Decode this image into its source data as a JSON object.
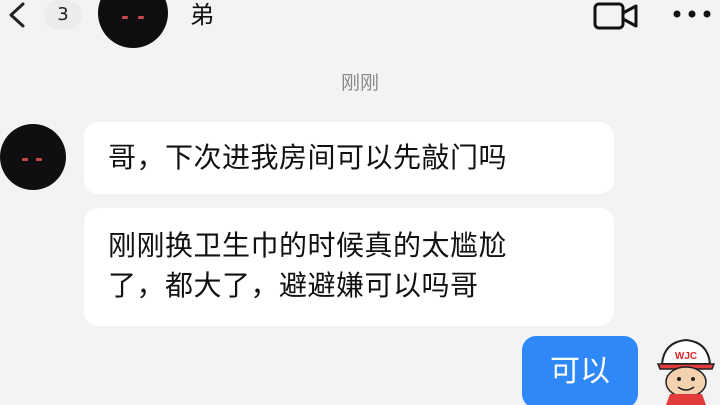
{
  "header": {
    "unread_count": "3",
    "contact_name": "弟",
    "icons": [
      "back-icon",
      "video-call-icon",
      "more-icon"
    ]
  },
  "timestamp": "刚刚",
  "messages": [
    {
      "direction": "incoming",
      "lines": [
        "哥，下次进我房间可以先敲门吗"
      ]
    },
    {
      "direction": "incoming",
      "lines": [
        "刚刚换卫生巾的时候真的太尴尬",
        "了，都大了，避避嫌可以吗哥"
      ]
    },
    {
      "direction": "outgoing",
      "lines": [
        "可以"
      ]
    }
  ],
  "my_avatar": {
    "cap_text": "WJC"
  },
  "colors": {
    "background": "#f3f3f4",
    "bubble_in": "#ffffff",
    "bubble_out": "#2f88f8",
    "timestamp": "#8a8a8e"
  }
}
